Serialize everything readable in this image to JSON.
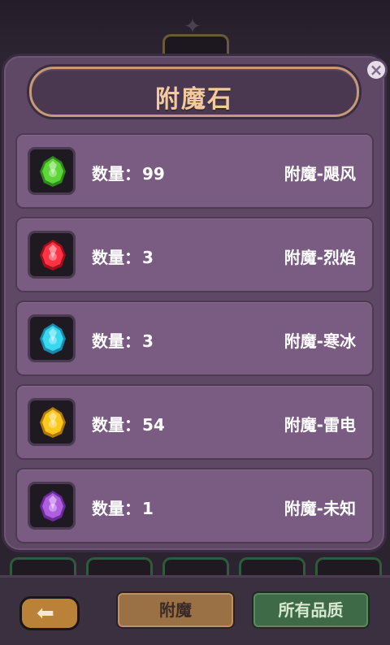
{
  "title": "附魔石",
  "items": [
    {
      "quantity_label": "数量：",
      "quantity": "99",
      "name": "附魔-飓风",
      "gem_color": "#5fd638",
      "gem_dark": "#2f8a1c",
      "gem_icon": "wind-gem-icon"
    },
    {
      "quantity_label": "数量：",
      "quantity": "3",
      "name": "附魔-烈焰",
      "gem_color": "#ff3344",
      "gem_dark": "#a30f1c",
      "gem_icon": "fire-gem-icon"
    },
    {
      "quantity_label": "数量：",
      "quantity": "3",
      "name": "附魔-寒冰",
      "gem_color": "#38d8f0",
      "gem_dark": "#1a8aa8",
      "gem_icon": "ice-gem-icon"
    },
    {
      "quantity_label": "数量：",
      "quantity": "54",
      "name": "附魔-雷电",
      "gem_color": "#ffc81c",
      "gem_dark": "#b07a0a",
      "gem_icon": "thunder-gem-icon"
    },
    {
      "quantity_label": "数量：",
      "quantity": "1",
      "name": "附魔-未知",
      "gem_color": "#b05ee0",
      "gem_dark": "#6a2a9a",
      "gem_icon": "unknown-gem-icon"
    }
  ],
  "bottom": {
    "enchant_label": "附魔",
    "quality_label": "所有品质"
  },
  "colors": {
    "panel": "#5e4866",
    "row": "#7a5b82",
    "title_text": "#f3c9a0",
    "enchant_button": "#9a7045",
    "quality_button": "#3f6a48"
  }
}
